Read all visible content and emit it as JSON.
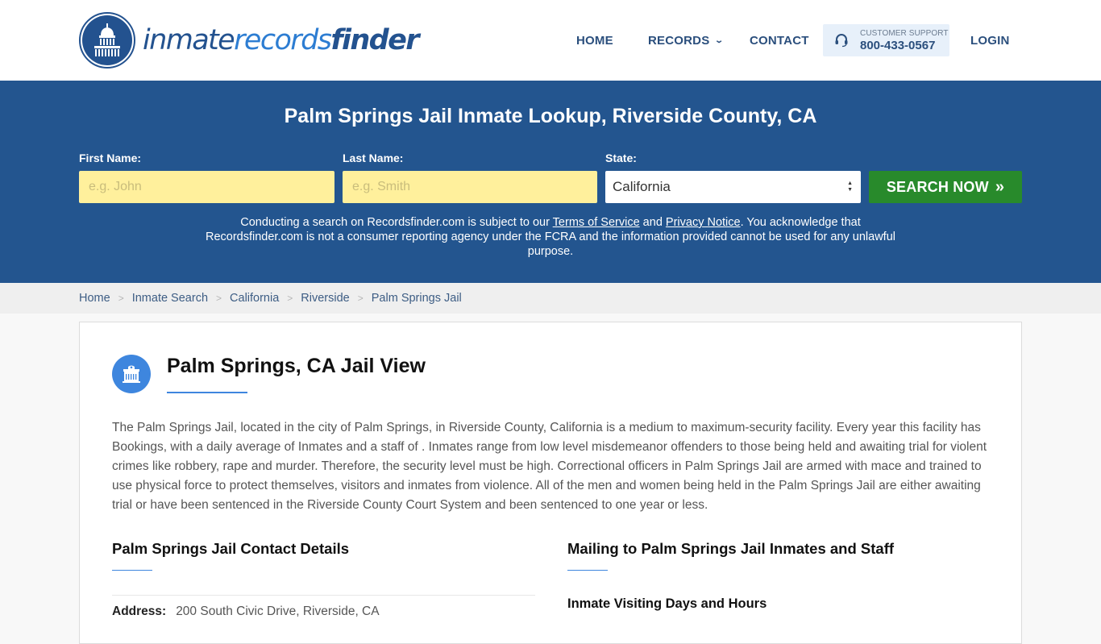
{
  "brand": {
    "part1": "inmate",
    "part2": "records",
    "part3": "finder"
  },
  "nav": {
    "home": "HOME",
    "records": "RECORDS",
    "contact": "CONTACT",
    "support_label": "CUSTOMER SUPPORT",
    "support_phone": "800-433-0567",
    "login": "LOGIN"
  },
  "search": {
    "title": "Palm Springs Jail Inmate Lookup, Riverside County, CA",
    "first_name_label": "First Name:",
    "first_name_placeholder": "e.g. John",
    "first_name_value": "",
    "last_name_label": "Last Name:",
    "last_name_placeholder": "e.g. Smith",
    "last_name_value": "",
    "state_label": "State:",
    "state_value": "California",
    "button_label": "SEARCH NOW",
    "disclaimer_part1": "Conducting a search on Recordsfinder.com is subject to our ",
    "terms_link": "Terms of Service",
    "disclaimer_and": " and ",
    "privacy_link": "Privacy Notice",
    "disclaimer_part2": ". You acknowledge that Recordsfinder.com is not a consumer reporting agency under the FCRA and the information provided cannot be used for any unlawful purpose."
  },
  "breadcrumb": {
    "items": [
      "Home",
      "Inmate Search",
      "California",
      "Riverside"
    ],
    "current": "Palm Springs Jail"
  },
  "main": {
    "title": "Palm Springs, CA Jail View",
    "intro": "The Palm Springs Jail, located in the city of Palm Springs, in Riverside County, California is a medium to maximum-security facility. Every year this facility has Bookings, with a daily average of Inmates and a staff of . Inmates range from low level misdemeanor offenders to those being held and awaiting trial for violent crimes like robbery, rape and murder. Therefore, the security level must be high. Correctional officers in Palm Springs Jail are armed with mace and trained to use physical force to protect themselves, visitors and inmates from violence. All of the men and women being held in the Palm Springs Jail are either awaiting trial or have been sentenced in the Riverside County Court System and been sentenced to one year or less.",
    "contact_title": "Palm Springs Jail Contact Details",
    "address_label": "Address:",
    "address_value": "200 South Civic Drive, Riverside, CA",
    "mailing_title": "Mailing to Palm Springs Jail Inmates and Staff",
    "visiting_title": "Inmate Visiting Days and Hours"
  },
  "colors": {
    "brand_blue": "#23558f",
    "accent_blue": "#3e86de",
    "search_green": "#288a2b",
    "input_yellow": "#fff09c"
  }
}
